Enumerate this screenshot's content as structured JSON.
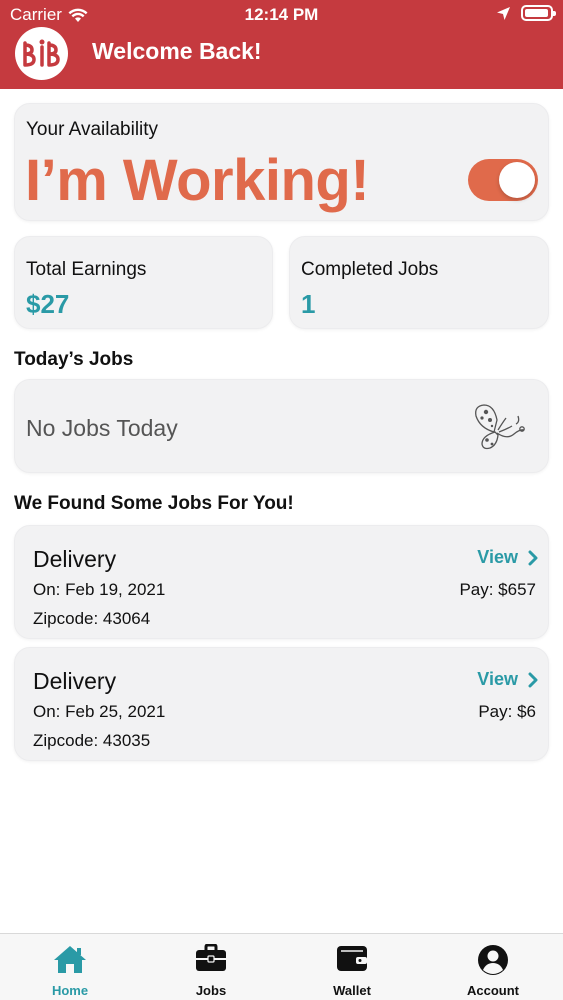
{
  "status_bar": {
    "carrier": "Carrier",
    "time": "12:14 PM"
  },
  "header": {
    "title": "Welcome Back!",
    "logo_text": "BIB",
    "color": "#c53a3f"
  },
  "availability": {
    "label": "Your Availability",
    "status": "I’m Working!",
    "toggle_on": true,
    "accent": "#e06a4b"
  },
  "stats": {
    "earnings": {
      "label": "Total Earnings",
      "value": "$27"
    },
    "completed": {
      "label": "Completed Jobs",
      "value": "1"
    },
    "value_color": "#2a9aa6"
  },
  "today": {
    "title": "Today’s Jobs",
    "empty_text": "No Jobs Today",
    "icon": "butterfly-icon"
  },
  "found": {
    "title": "We Found Some Jobs For You!",
    "jobs": [
      {
        "type": "Delivery",
        "date": "On: Feb 19, 2021",
        "zip": "Zipcode: 43064",
        "view": "View",
        "pay": "Pay: $657"
      },
      {
        "type": "Delivery",
        "date": "On: Feb 25, 2021",
        "zip": "Zipcode: 43035",
        "view": "View",
        "pay": "Pay: $6"
      }
    ]
  },
  "tabs": [
    {
      "label": "Home",
      "icon": "home-icon",
      "active": true
    },
    {
      "label": "Jobs",
      "icon": "briefcase-icon",
      "active": false
    },
    {
      "label": "Wallet",
      "icon": "wallet-icon",
      "active": false
    },
    {
      "label": "Account",
      "icon": "account-icon",
      "active": false
    }
  ]
}
